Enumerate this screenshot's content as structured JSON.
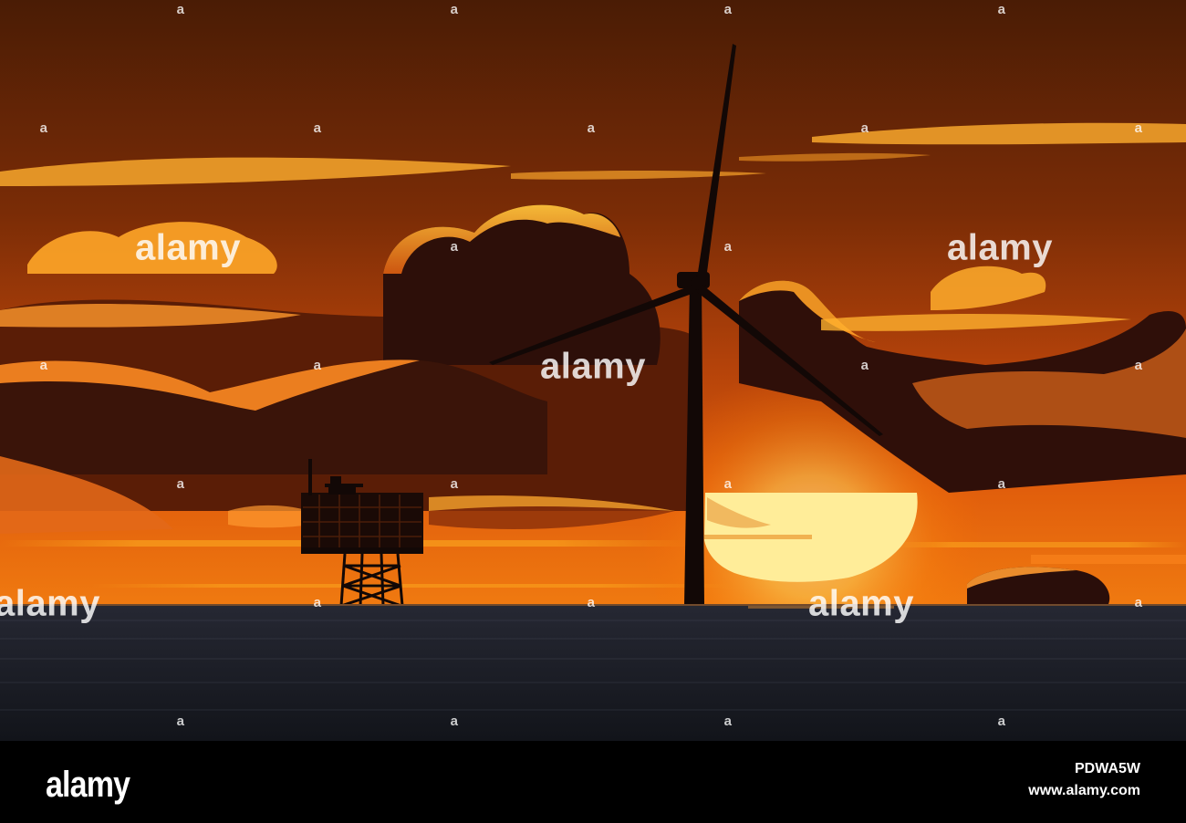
{
  "watermark": {
    "small_mark": "a",
    "large_mark": "alamy"
  },
  "footer": {
    "brand": "alamy",
    "image_id": "PDWA5W",
    "site": "www.alamy.com"
  },
  "colors": {
    "sky_top": "#4a1a04",
    "sky_glow": "#e0580a",
    "cloud_highlight": "#ffb21e",
    "cloud_dark": "#2e0f08",
    "sun": "#fff1a8",
    "sea": "#1a1d24",
    "silhouette": "#120806"
  }
}
